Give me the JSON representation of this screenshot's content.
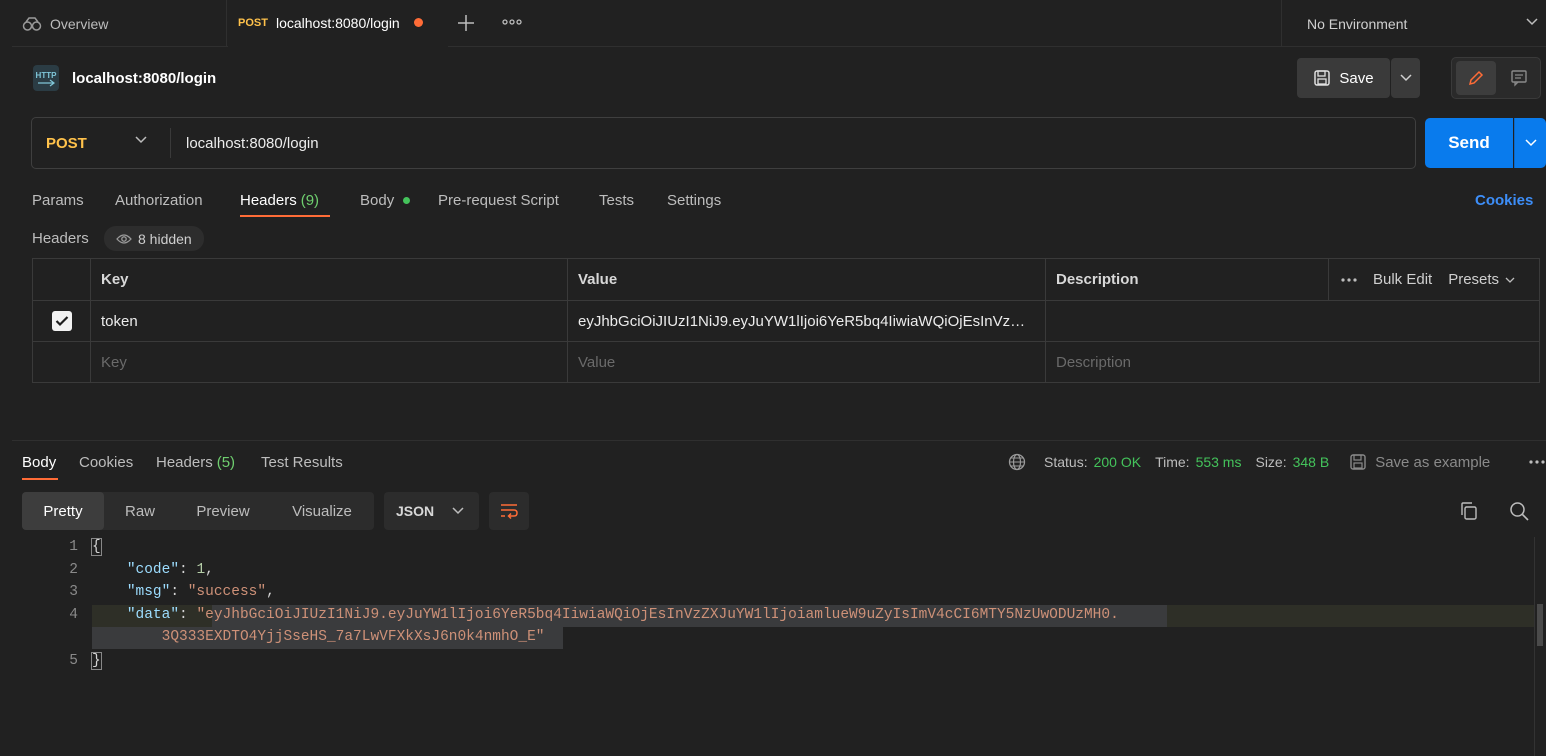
{
  "tabs": {
    "overview_label": "Overview",
    "active_method": "POST",
    "active_label": "localhost:8080/login"
  },
  "environment": {
    "label": "No Environment"
  },
  "request": {
    "title": "localhost:8080/login",
    "save_label": "Save",
    "method": "POST",
    "url": "localhost:8080/login",
    "send_label": "Send"
  },
  "request_tabs": {
    "params": "Params",
    "authorization": "Authorization",
    "headers": "Headers",
    "headers_count": "(9)",
    "body": "Body",
    "prerequest": "Pre-request Script",
    "tests": "Tests",
    "settings": "Settings",
    "cookies": "Cookies"
  },
  "headers_section": {
    "label": "Headers",
    "hidden": "8 hidden",
    "columns": {
      "key": "Key",
      "value": "Value",
      "description": "Description"
    },
    "bulk_edit": "Bulk Edit",
    "presets": "Presets",
    "rows": [
      {
        "checked": true,
        "key": "token",
        "value": "eyJhbGciOiJIUzI1NiJ9.eyJuYW1lIjoi6YeR5bq4IiwiaWQiOjEsInVz…",
        "description": ""
      }
    ],
    "placeholders": {
      "key": "Key",
      "value": "Value",
      "description": "Description"
    }
  },
  "response": {
    "tabs": {
      "body": "Body",
      "cookies": "Cookies",
      "headers": "Headers",
      "headers_count": "(5)",
      "test_results": "Test Results"
    },
    "status_label": "Status:",
    "status_value": "200 OK",
    "time_label": "Time:",
    "time_value": "553 ms",
    "size_label": "Size:",
    "size_value": "348 B",
    "save_example": "Save as example",
    "views": [
      "Pretty",
      "Raw",
      "Preview",
      "Visualize"
    ],
    "format": "JSON",
    "code_lines": {
      "l1": "{",
      "l2_key": "\"code\"",
      "l2_val": "1",
      "l3_key": "\"msg\"",
      "l3_val": "\"success\"",
      "l4_key": "\"data\"",
      "l4_val_a": "\"eyJhbGciOiJIUzI1NiJ9.eyJuYW1lIjoi6YeR5bq4IiwiaWQiOjEsInVzZXJuYW1lIjoiamlueW9uZyIsImV4cCI6MTY5NzUwODUzMH0.",
      "l4_val_b": "3Q333EXDTO4YjjSseHS_7a7LwVFXkXsJ6n0k4nmhO_E\"",
      "l5": "}"
    }
  }
}
